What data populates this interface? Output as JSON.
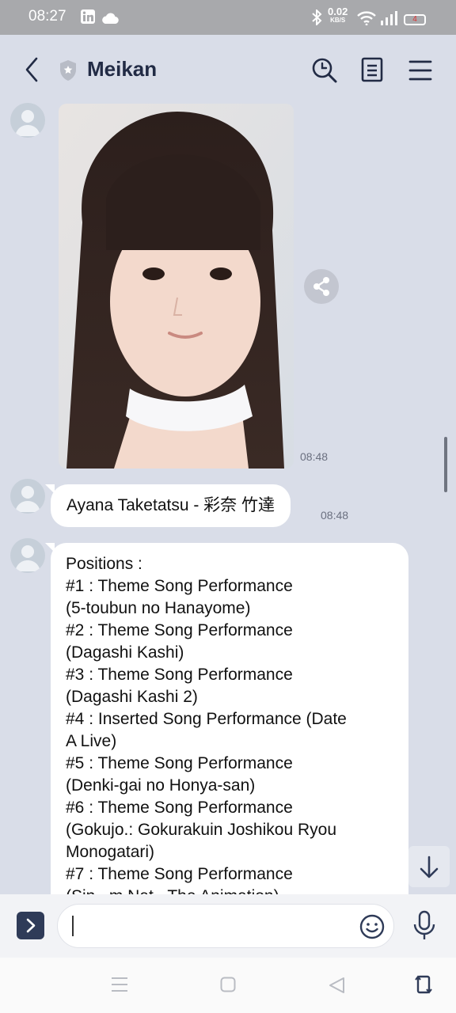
{
  "status_bar": {
    "time": "08:27",
    "net_speed_value": "0.02",
    "net_speed_unit": "KB/S",
    "battery_level": "4",
    "icons": [
      "linkedin-icon",
      "cloud-icon",
      "bluetooth-icon",
      "wifi-icon",
      "signal-icon",
      "battery-icon"
    ]
  },
  "header": {
    "title": "Meikan",
    "icons": [
      "back-arrow-icon",
      "shield-icon",
      "search-icon",
      "notes-icon",
      "menu-icon"
    ]
  },
  "messages": [
    {
      "type": "image",
      "time": "08:48"
    },
    {
      "type": "text",
      "time": "08:48",
      "text": "Ayana Taketatsu - 彩奈 竹達"
    },
    {
      "type": "text",
      "time": "",
      "lines": [
        "Positions :",
        "#1 : Theme Song Performance",
        "(5-toubun no Hanayome)",
        "#2 : Theme Song Performance",
        "(Dagashi Kashi)",
        "#3 : Theme Song Performance",
        "(Dagashi Kashi 2)",
        "#4 : Inserted Song Performance (Date",
        "A Live)",
        "#5 : Theme Song Performance",
        "(Denki-gai no Honya-san)",
        "#6 : Theme Song Performance",
        "(Gokujo.: Gokurakuin Joshikou Ryou",
        "Monogatari)",
        "#7 : Theme Song Performance",
        "(Sin...m Nat...The Animation)"
      ]
    }
  ],
  "input": {
    "placeholder": ""
  },
  "colors": {
    "chat_bg": "#d9dde8",
    "header_title": "#222b45",
    "send_button": "#2f3b58"
  }
}
